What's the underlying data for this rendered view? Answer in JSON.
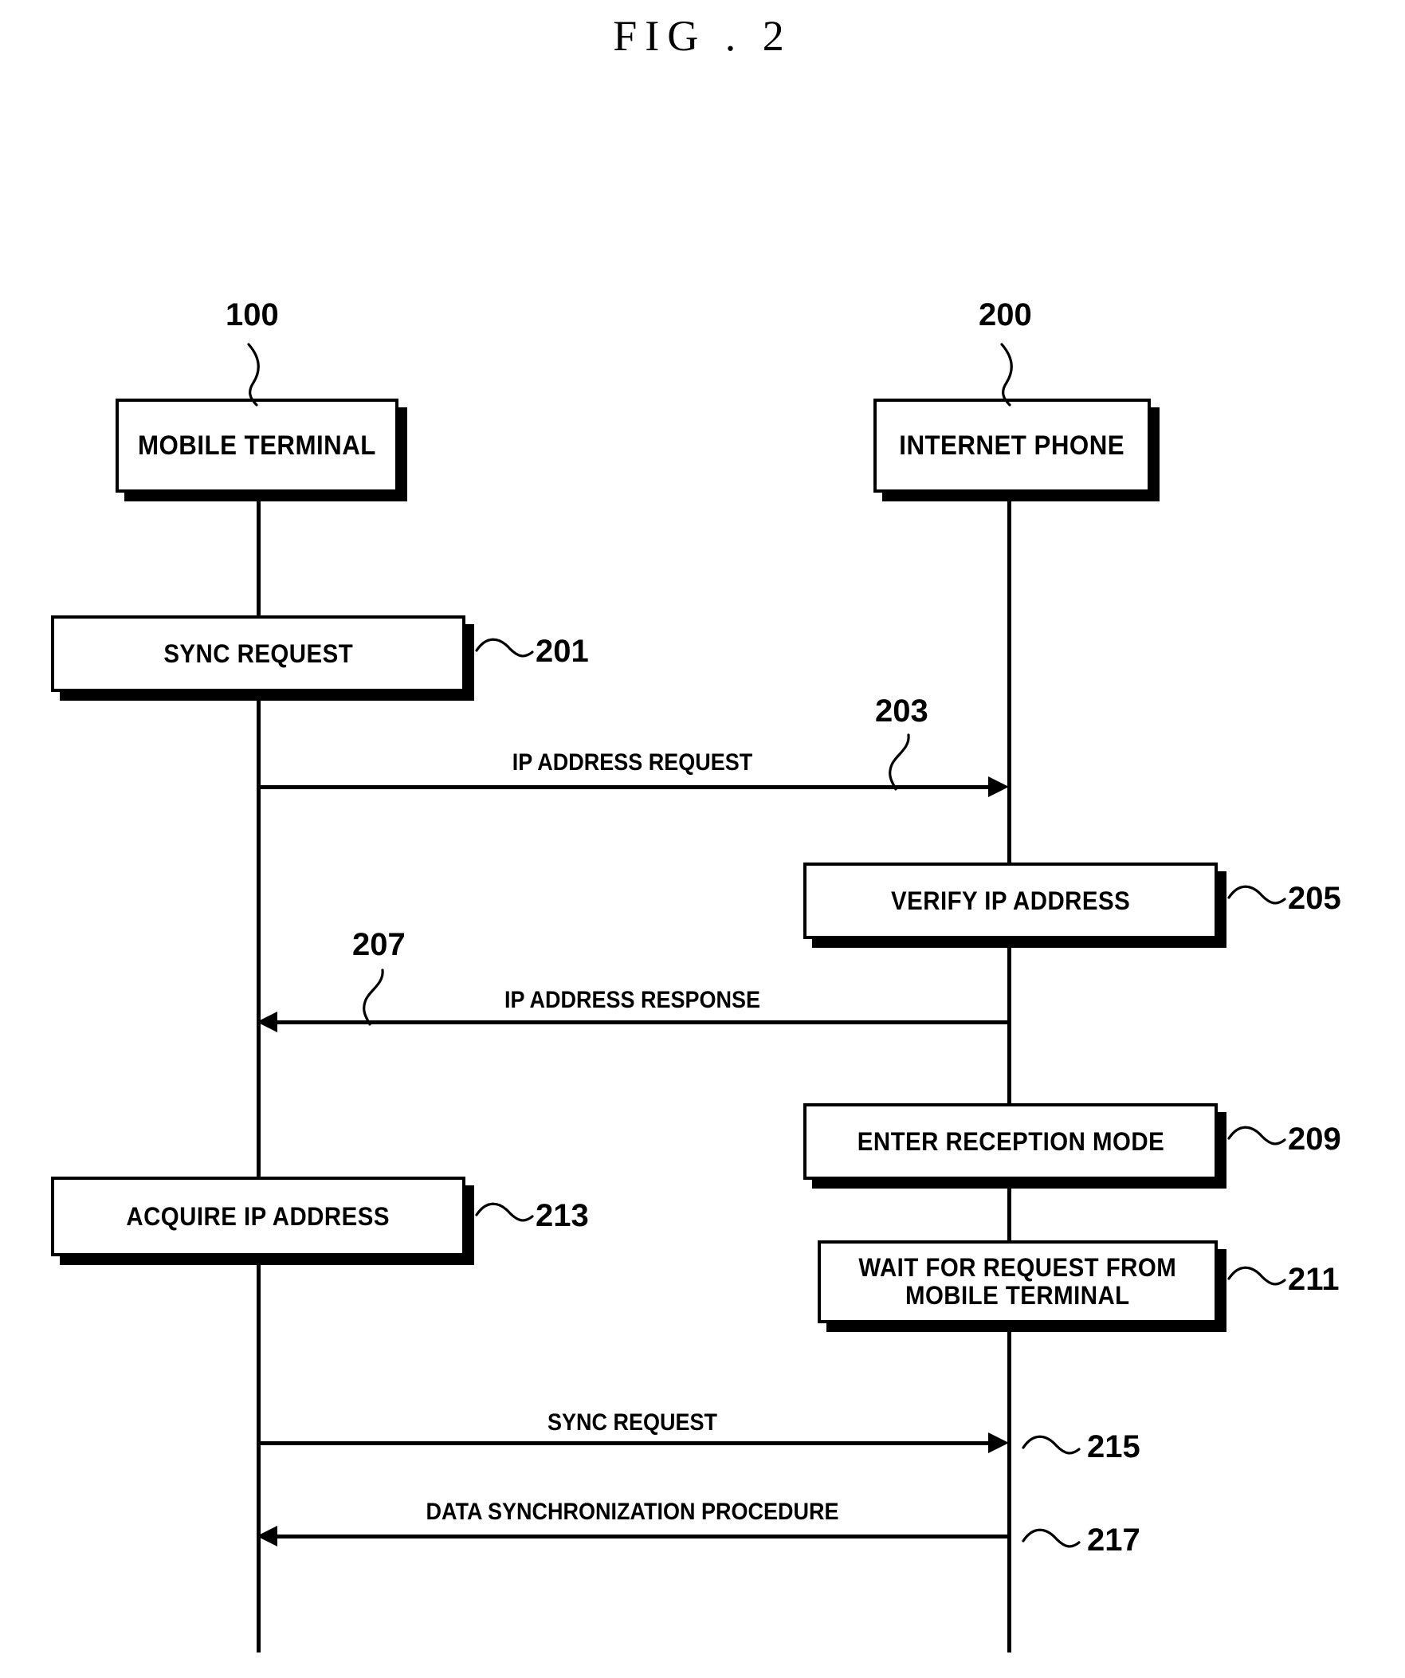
{
  "figure": {
    "title": "FIG . 2",
    "type": "sequence-diagram"
  },
  "lifelines": [
    {
      "id": "mobile_terminal",
      "ref": "100",
      "label": "MOBILE TERMINAL"
    },
    {
      "id": "internet_phone",
      "ref": "200",
      "label": "INTERNET PHONE"
    }
  ],
  "steps": [
    {
      "ref": "201",
      "label": "SYNC REQUEST",
      "kind": "process",
      "actor": "mobile_terminal"
    },
    {
      "ref": "203",
      "label": "IP ADDRESS REQUEST",
      "kind": "message",
      "direction": "right"
    },
    {
      "ref": "205",
      "label": "VERIFY IP ADDRESS",
      "kind": "process",
      "actor": "internet_phone"
    },
    {
      "ref": "207",
      "label": "IP ADDRESS RESPONSE",
      "kind": "message",
      "direction": "left"
    },
    {
      "ref": "209",
      "label": "ENTER RECEPTION MODE",
      "kind": "process",
      "actor": "internet_phone"
    },
    {
      "ref": "211",
      "label": "WAIT FOR REQUEST FROM\nMOBILE TERMINAL",
      "kind": "process",
      "actor": "internet_phone"
    },
    {
      "ref": "213",
      "label": "ACQUIRE IP ADDRESS",
      "kind": "process",
      "actor": "mobile_terminal"
    },
    {
      "ref": "215",
      "label": "SYNC REQUEST",
      "kind": "message",
      "direction": "right"
    },
    {
      "ref": "217",
      "label": "DATA SYNCHRONIZATION PROCEDURE",
      "kind": "message",
      "direction": "left"
    }
  ],
  "colors": {
    "ink": "#000000",
    "paper": "#ffffff"
  }
}
